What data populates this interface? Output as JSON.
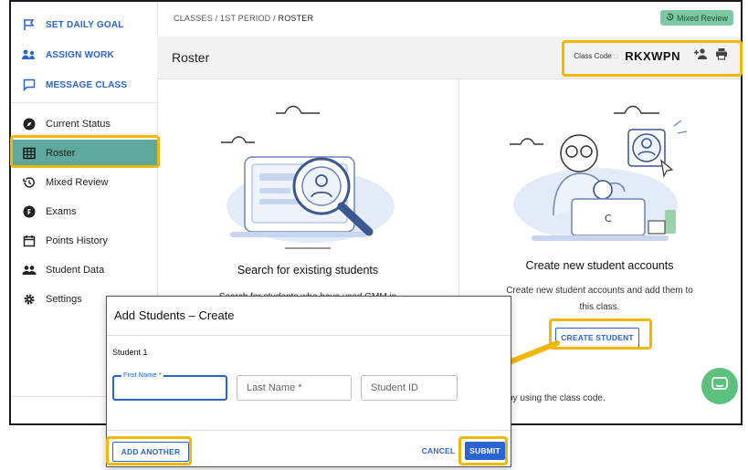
{
  "sidebar": {
    "actions": [
      {
        "label": "SET DAILY GOAL",
        "icon": "flag-icon"
      },
      {
        "label": "ASSIGN WORK",
        "icon": "assign-icon"
      },
      {
        "label": "MESSAGE CLASS",
        "icon": "message-icon"
      }
    ],
    "nav": [
      {
        "label": "Current Status",
        "icon": "compass-icon"
      },
      {
        "label": "Roster",
        "icon": "table-icon",
        "active": true
      },
      {
        "label": "Mixed Review",
        "icon": "history-icon"
      },
      {
        "label": "Exams",
        "icon": "exam-icon"
      },
      {
        "label": "Points History",
        "icon": "calendar-icon"
      },
      {
        "label": "Student Data",
        "icon": "people-icon"
      },
      {
        "label": "Settings",
        "icon": "gear-icon"
      }
    ]
  },
  "breadcrumb": {
    "part1": "CLASSES",
    "sep": "/",
    "part2": "1ST PERIOD",
    "part3": "ROSTER"
  },
  "badge": {
    "label": "Mixed Review"
  },
  "header": {
    "title": "Roster",
    "class_code_label": "Class Code",
    "class_code_value": "RKXWPN"
  },
  "search_card": {
    "title": "Search for existing students",
    "desc": "Search for students who have used GMM in"
  },
  "create_card": {
    "title": "Create new student accounts",
    "desc_line1": "Create new student accounts and add them to",
    "desc_line2": "this class.",
    "button": "CREATE STUDENT",
    "code_hint": "by using the class code."
  },
  "dialog": {
    "title": "Add Students – Create",
    "student_label": "Student 1",
    "first_name_label": "First Name *",
    "last_name_placeholder": "Last Name *",
    "student_id_placeholder": "Student ID",
    "add_another": "ADD ANOTHER",
    "cancel": "CANCEL",
    "submit": "SUBMIT"
  },
  "colors": {
    "accent": "#2a64d4",
    "active_nav": "#5fa89e",
    "highlight": "#f2b705",
    "badge": "#7dc9a4",
    "chat": "#5cc17c",
    "arrow": "#f2b705"
  }
}
